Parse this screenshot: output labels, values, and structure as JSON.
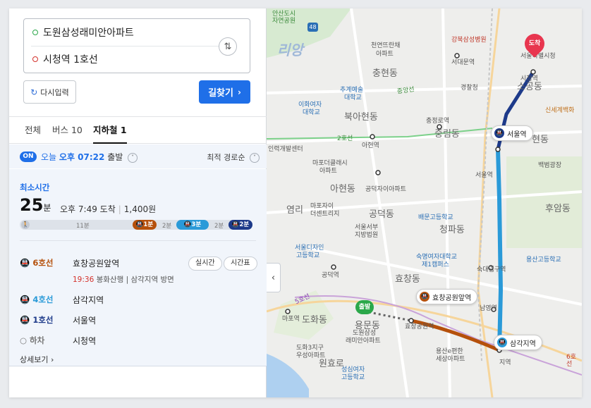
{
  "route": {
    "origin": "도원삼성래미안아파트",
    "destination": "시청역 1호선",
    "reset_label": "다시입력",
    "search_label": "길찾기",
    "colors": {
      "origin_dot": "#2ba84a",
      "destination_dot": "#d4322c",
      "primary": "#1f6fe8"
    }
  },
  "tabs": [
    {
      "label": "전체"
    },
    {
      "label": "버스 10"
    },
    {
      "label": "지하철 1"
    }
  ],
  "options": {
    "on_badge": "ON",
    "departure_prefix": "오늘 ",
    "departure_ampm": "오후",
    "departure_time": " 07:22",
    "departure_suffix": " 출발",
    "sort_label": "최적 경로순"
  },
  "result": {
    "label": "최소시간",
    "duration": "25",
    "duration_unit": "분",
    "arrival": "오후 7:49 도착",
    "fare": "1,400원",
    "segments": [
      {
        "mode": "walk",
        "minutes_label": "11분",
        "value": 11
      },
      {
        "mode": "line6",
        "badge": "1분",
        "value": 1
      },
      {
        "mode": "transfer",
        "minutes_label": "2분",
        "value": 2
      },
      {
        "mode": "line4",
        "badge": "3분",
        "value": 3
      },
      {
        "mode": "transfer",
        "minutes_label": "2분",
        "value": 2
      },
      {
        "mode": "line1",
        "badge": "2분",
        "value": 2
      }
    ],
    "steps": [
      {
        "line": "6호선",
        "station": "효창공원앞역",
        "color": "#b5500b"
      },
      {
        "line": "4호선",
        "station": "삼각지역",
        "color": "#2a9ad8"
      },
      {
        "line": "1호선",
        "station": "서울역",
        "color": "#1d3a8a"
      },
      {
        "line": "하차",
        "station": "시청역",
        "color": "#777777"
      }
    ],
    "sub_time": "19:36",
    "sub_text": "봉화산행 | 삼각지역 방면",
    "realtime_label": "실시간",
    "timetable_label": "시간표",
    "detail_label": "상세보기"
  },
  "map": {
    "labels": [
      {
        "text": "안산도시",
        "kind": "area"
      },
      {
        "text": "자연공원",
        "kind": "area"
      },
      {
        "text": "강북삼성병원",
        "kind": "poi-red"
      },
      {
        "text": "천연뜨란채",
        "kind": "poi"
      },
      {
        "text": "아파트",
        "kind": "poi"
      },
      {
        "text": "서대문역",
        "kind": "station"
      },
      {
        "text": "경찰청",
        "kind": "poi"
      },
      {
        "text": "충현동",
        "kind": "district"
      },
      {
        "text": "추계예술",
        "kind": "poi-blue"
      },
      {
        "text": "대학교",
        "kind": "poi-blue"
      },
      {
        "text": "이화여자",
        "kind": "poi-blue"
      },
      {
        "text": "대학교",
        "kind": "poi-blue"
      },
      {
        "text": "북아현동",
        "kind": "district"
      },
      {
        "text": "충정로역",
        "kind": "station"
      },
      {
        "text": "중림동",
        "kind": "district"
      },
      {
        "text": "아현역",
        "kind": "station"
      },
      {
        "text": "인력개발센터",
        "kind": "poi"
      },
      {
        "text": "마포더클래시",
        "kind": "poi"
      },
      {
        "text": "아파트",
        "kind": "poi"
      },
      {
        "text": "아현동",
        "kind": "district"
      },
      {
        "text": "공덕자이아파트",
        "kind": "poi"
      },
      {
        "text": "염리",
        "kind": "district"
      },
      {
        "text": "마포자이",
        "kind": "poi"
      },
      {
        "text": "더센트리지",
        "kind": "poi"
      },
      {
        "text": "공덕동",
        "kind": "district"
      },
      {
        "text": "서울서부",
        "kind": "poi"
      },
      {
        "text": "지방법원",
        "kind": "poi"
      },
      {
        "text": "배문고등학교",
        "kind": "poi-blue"
      },
      {
        "text": "청파동",
        "kind": "district"
      },
      {
        "text": "서울디자인",
        "kind": "poi-blue"
      },
      {
        "text": "고등학교",
        "kind": "poi-blue"
      },
      {
        "text": "숙명여자대학교",
        "kind": "poi-blue"
      },
      {
        "text": "제1캠퍼스",
        "kind": "poi-blue"
      },
      {
        "text": "공덕역",
        "kind": "station"
      },
      {
        "text": "효창동",
        "kind": "district"
      },
      {
        "text": "마포역",
        "kind": "station"
      },
      {
        "text": "도화동",
        "kind": "district"
      },
      {
        "text": "용문동",
        "kind": "district"
      },
      {
        "text": "효창공원역",
        "kind": "station"
      },
      {
        "text": "도원삼성",
        "kind": "poi"
      },
      {
        "text": "래미안아파트",
        "kind": "poi"
      },
      {
        "text": "도화3지구",
        "kind": "poi"
      },
      {
        "text": "우성아파트",
        "kind": "poi"
      },
      {
        "text": "원효로",
        "kind": "district"
      },
      {
        "text": "성심여자",
        "kind": "poi-blue"
      },
      {
        "text": "고등학교",
        "kind": "poi-blue"
      },
      {
        "text": "용산e편한",
        "kind": "poi"
      },
      {
        "text": "세상아파트",
        "kind": "poi"
      },
      {
        "text": "숙대입구역",
        "kind": "station"
      },
      {
        "text": "남영역",
        "kind": "station"
      },
      {
        "text": "용산고등학교",
        "kind": "poi-blue"
      },
      {
        "text": "후암동",
        "kind": "district"
      },
      {
        "text": "백범광장",
        "kind": "poi"
      },
      {
        "text": "현동",
        "kind": "district"
      },
      {
        "text": "서울역",
        "kind": "station"
      },
      {
        "text": "신세계백화",
        "kind": "poi-orange"
      },
      {
        "text": "서울특별시청",
        "kind": "poi"
      },
      {
        "text": "소공동",
        "kind": "district"
      },
      {
        "text": "시청역",
        "kind": "station"
      },
      {
        "text": "5호선",
        "kind": "line-red"
      },
      {
        "text": "6호선",
        "kind": "line-red"
      },
      {
        "text": "48",
        "kind": "route-badge"
      },
      {
        "text": "리앙",
        "kind": "logo"
      },
      {
        "text": "삼각지역",
        "kind": "station"
      },
      {
        "text": "지역",
        "kind": "station"
      },
      {
        "text": "중앙선",
        "kind": "line-green"
      },
      {
        "text": "2호선",
        "kind": "line-green"
      }
    ],
    "markers": {
      "start": "출발",
      "end": "도착",
      "hyochang": "효창공원앞역",
      "samgakji": "삼각지역",
      "seoul": "서울역"
    },
    "colors": {
      "line6": "#b5500b",
      "line4": "#2a9ad8",
      "line1": "#1d3a8a",
      "line2": "#35b34a",
      "line5": "#8a3ab9"
    }
  }
}
